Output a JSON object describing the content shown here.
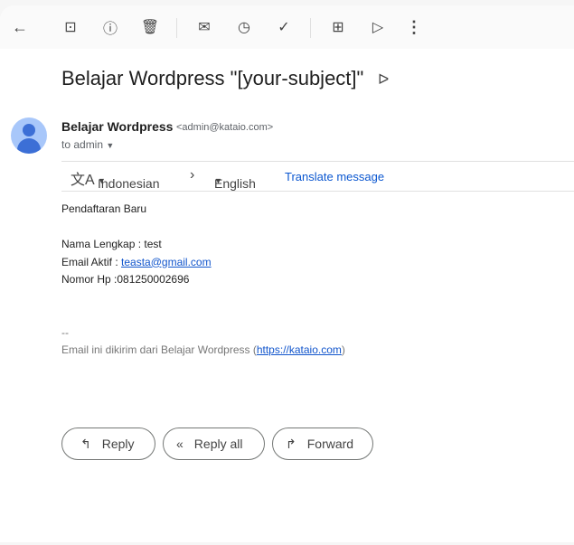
{
  "toolbar": {
    "icons": [
      "back-icon",
      "archive-icon",
      "report-spam-icon",
      "delete-icon",
      "mark-unread-icon",
      "snooze-icon",
      "add-task-icon",
      "move-to-icon",
      "label-icon",
      "more-icon"
    ]
  },
  "subject": "Belajar Wordpress \"[your-subject]\"",
  "sender": {
    "name": "Belajar Wordpress",
    "email": "<admin@kataio.com>",
    "to": "to admin"
  },
  "translate": {
    "from": "Indonesian",
    "to": "English",
    "action": "Translate message"
  },
  "body": {
    "line1": "Pendaftaran Baru",
    "name": "Nama Lengkap : test",
    "email_label": "Email Aktif : ",
    "email_value": "teasta@gmail.com",
    "phone": "Nomor Hp :081250002696",
    "sig_dash": "--",
    "sig_text": "Email ini dikirim dari Belajar Wordpress (",
    "sig_link": "https://kataio.com",
    "sig_end": ")"
  },
  "actions": {
    "reply": "Reply",
    "reply_all": "Reply all",
    "forward": "Forward"
  }
}
